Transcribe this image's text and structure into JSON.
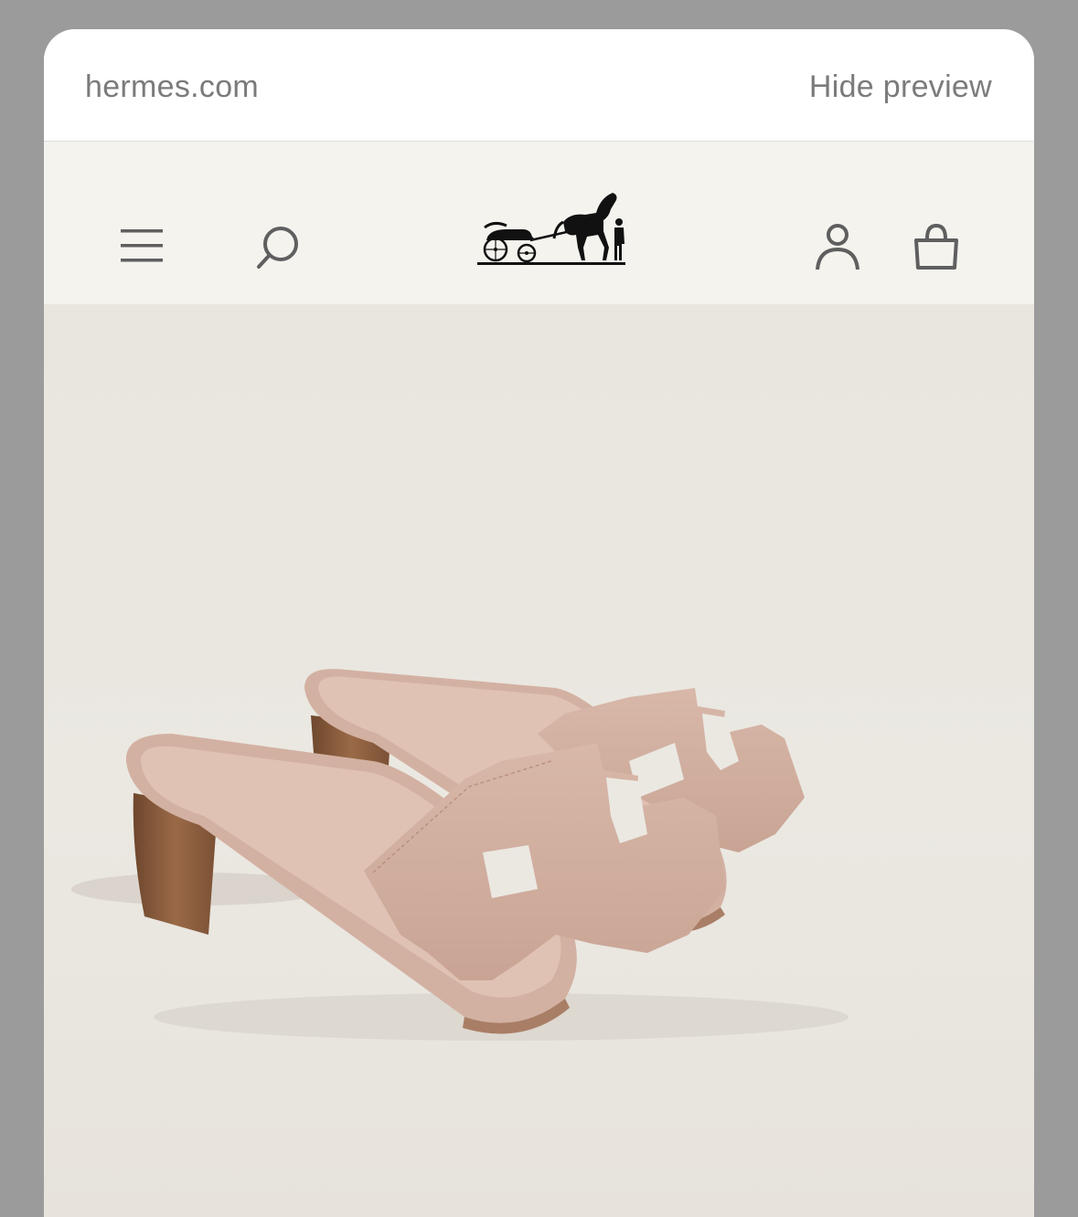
{
  "preview": {
    "domain": "hermes.com",
    "hide_label": "Hide preview"
  },
  "header": {
    "icons": [
      "menu-icon",
      "search-icon",
      "account-icon",
      "shopping-bag-icon"
    ],
    "logo": "hermes-carriage-logo"
  },
  "hero": {
    "subject": "product-image-sandals"
  },
  "colors": {
    "header_bg": "#f5f3ee",
    "hero_bg": "#e9e5df",
    "icon": "#5f5f5f",
    "preview_text": "#7b7b7b",
    "sandal_leather": "#d2b1a2",
    "heel_wood": "#8a5f40"
  }
}
